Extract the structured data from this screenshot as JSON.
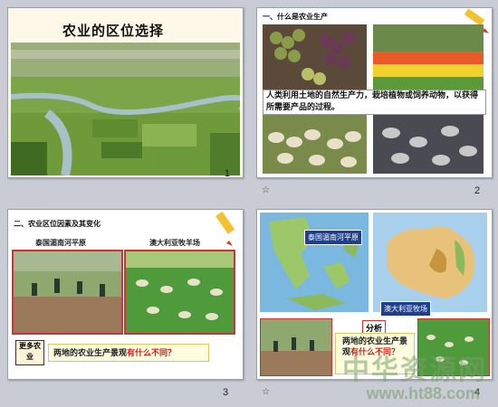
{
  "slides": [
    {
      "number": "1",
      "title": "农业的区位选择"
    },
    {
      "number": "2",
      "heading": "一、什么是农业生产",
      "definition": "人类利用土地的自然生产力，栽培植物或饲养动物，以获得所需要产品的过程。"
    },
    {
      "number": "3",
      "heading": "二、农业区位因素及其变化",
      "caption_left": "泰国湄南河平原",
      "caption_right": "澳大利亚牧羊场",
      "badge": "更多农业",
      "question_prefix": "两地的农业生产景观",
      "question_highlight": "有什么不同？"
    },
    {
      "number": "4",
      "label_thailand": "泰国湄南河平原",
      "label_australia": "澳大利亚牧场",
      "analysis_label": "分析",
      "analysis_text_prefix": "两地的农业生产景观",
      "analysis_text_highlight": "有什么不同？"
    }
  ],
  "star_glyph": "☆",
  "watermark": {
    "cn": "中华资源网",
    "url": "www.ht88.com"
  }
}
